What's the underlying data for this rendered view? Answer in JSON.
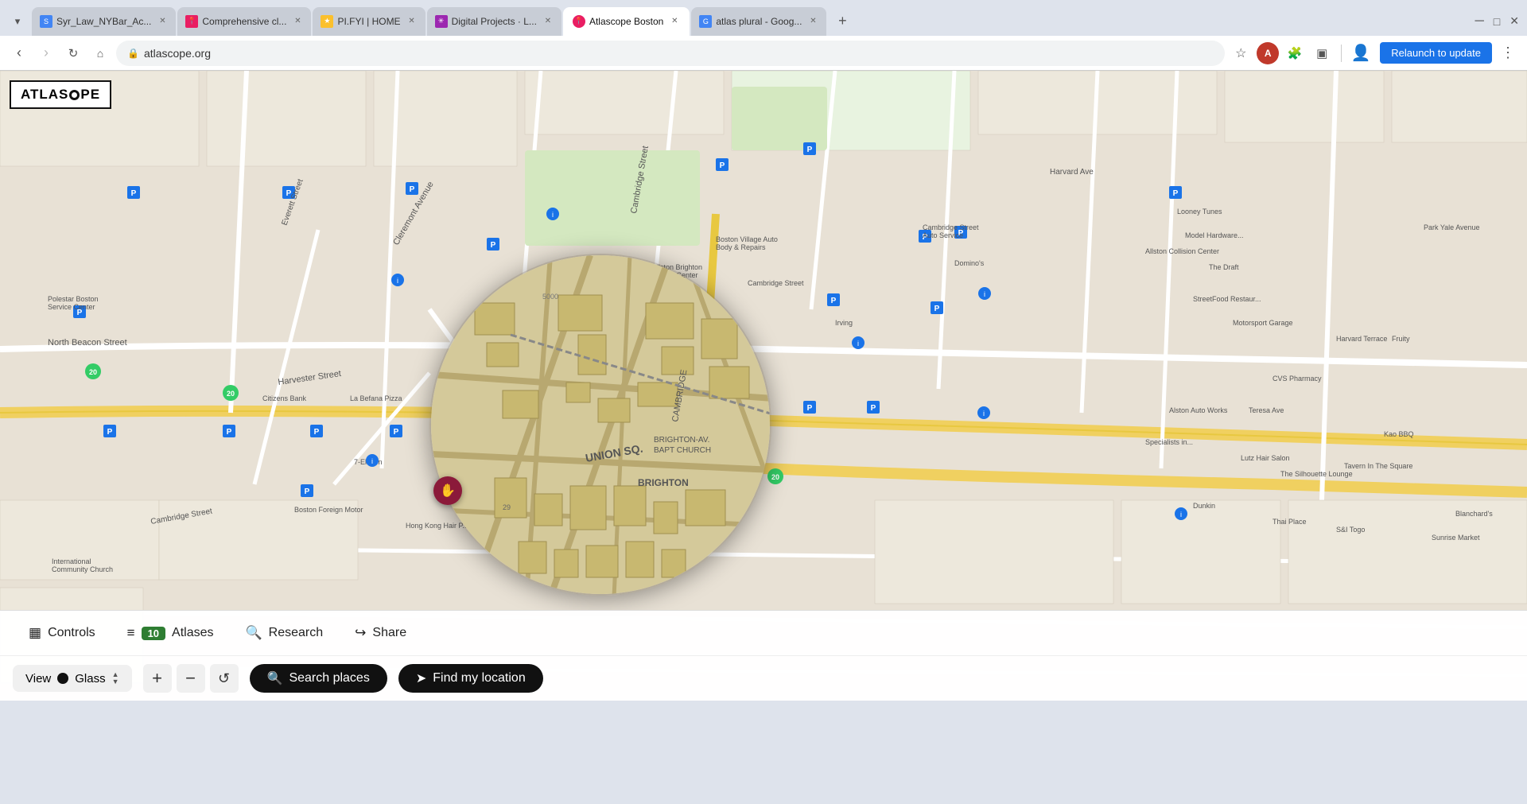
{
  "browser": {
    "tabs": [
      {
        "id": "tab1",
        "label": "Syr_Law_NYBar_Ac...",
        "favicon_color": "#4285f4",
        "favicon_char": "S",
        "active": false
      },
      {
        "id": "tab2",
        "label": "Comprehensive cl...",
        "favicon_color": "#e91e63",
        "favicon_char": "📍",
        "active": false
      },
      {
        "id": "tab3",
        "label": "PI.FYI | HOME",
        "favicon_color": "#fbc02d",
        "favicon_char": "★",
        "active": false
      },
      {
        "id": "tab4",
        "label": "Digital Projects · L...",
        "favicon_color": "#9c27b0",
        "favicon_char": "✳",
        "active": false
      },
      {
        "id": "tab5",
        "label": "Atlascope Boston",
        "favicon_color": "#e91e63",
        "favicon_char": "📍",
        "active": true
      },
      {
        "id": "tab6",
        "label": "atlas plural - Goog...",
        "favicon_color": "#4285f4",
        "favicon_char": "G",
        "active": false
      }
    ],
    "url": "atlascope.org",
    "relaunch_label": "Relaunch to update",
    "profile_initial": "A"
  },
  "logo": {
    "text_before": "ATLAS",
    "text_after": "PE"
  },
  "map": {
    "streets": [
      "Harvester Street",
      "Cleremont Avenue",
      "North Beacon Street",
      "Cambridge Street",
      "Allston Brighton Islamic Center",
      "Citizens Bank",
      "La Befana Pizza",
      "Union Sq.",
      "Cambridge",
      "Brighton",
      "Brighton Ave Bapt Church",
      "Polestar Boston Service Center",
      "Boston Foreign Motor",
      "International Community Church",
      "Hong Kong Hair P...",
      "7-Eleven"
    ]
  },
  "toolbar": {
    "controls_label": "Controls",
    "atlases_label": "Atlases",
    "atlases_count": "10",
    "research_label": "Research",
    "share_label": "Share",
    "view_label": "View",
    "glass_label": "Glass",
    "zoom_in": "+",
    "zoom_out": "−",
    "zoom_reset": "↺",
    "search_places_label": "Search places",
    "find_location_label": "Find my location"
  }
}
